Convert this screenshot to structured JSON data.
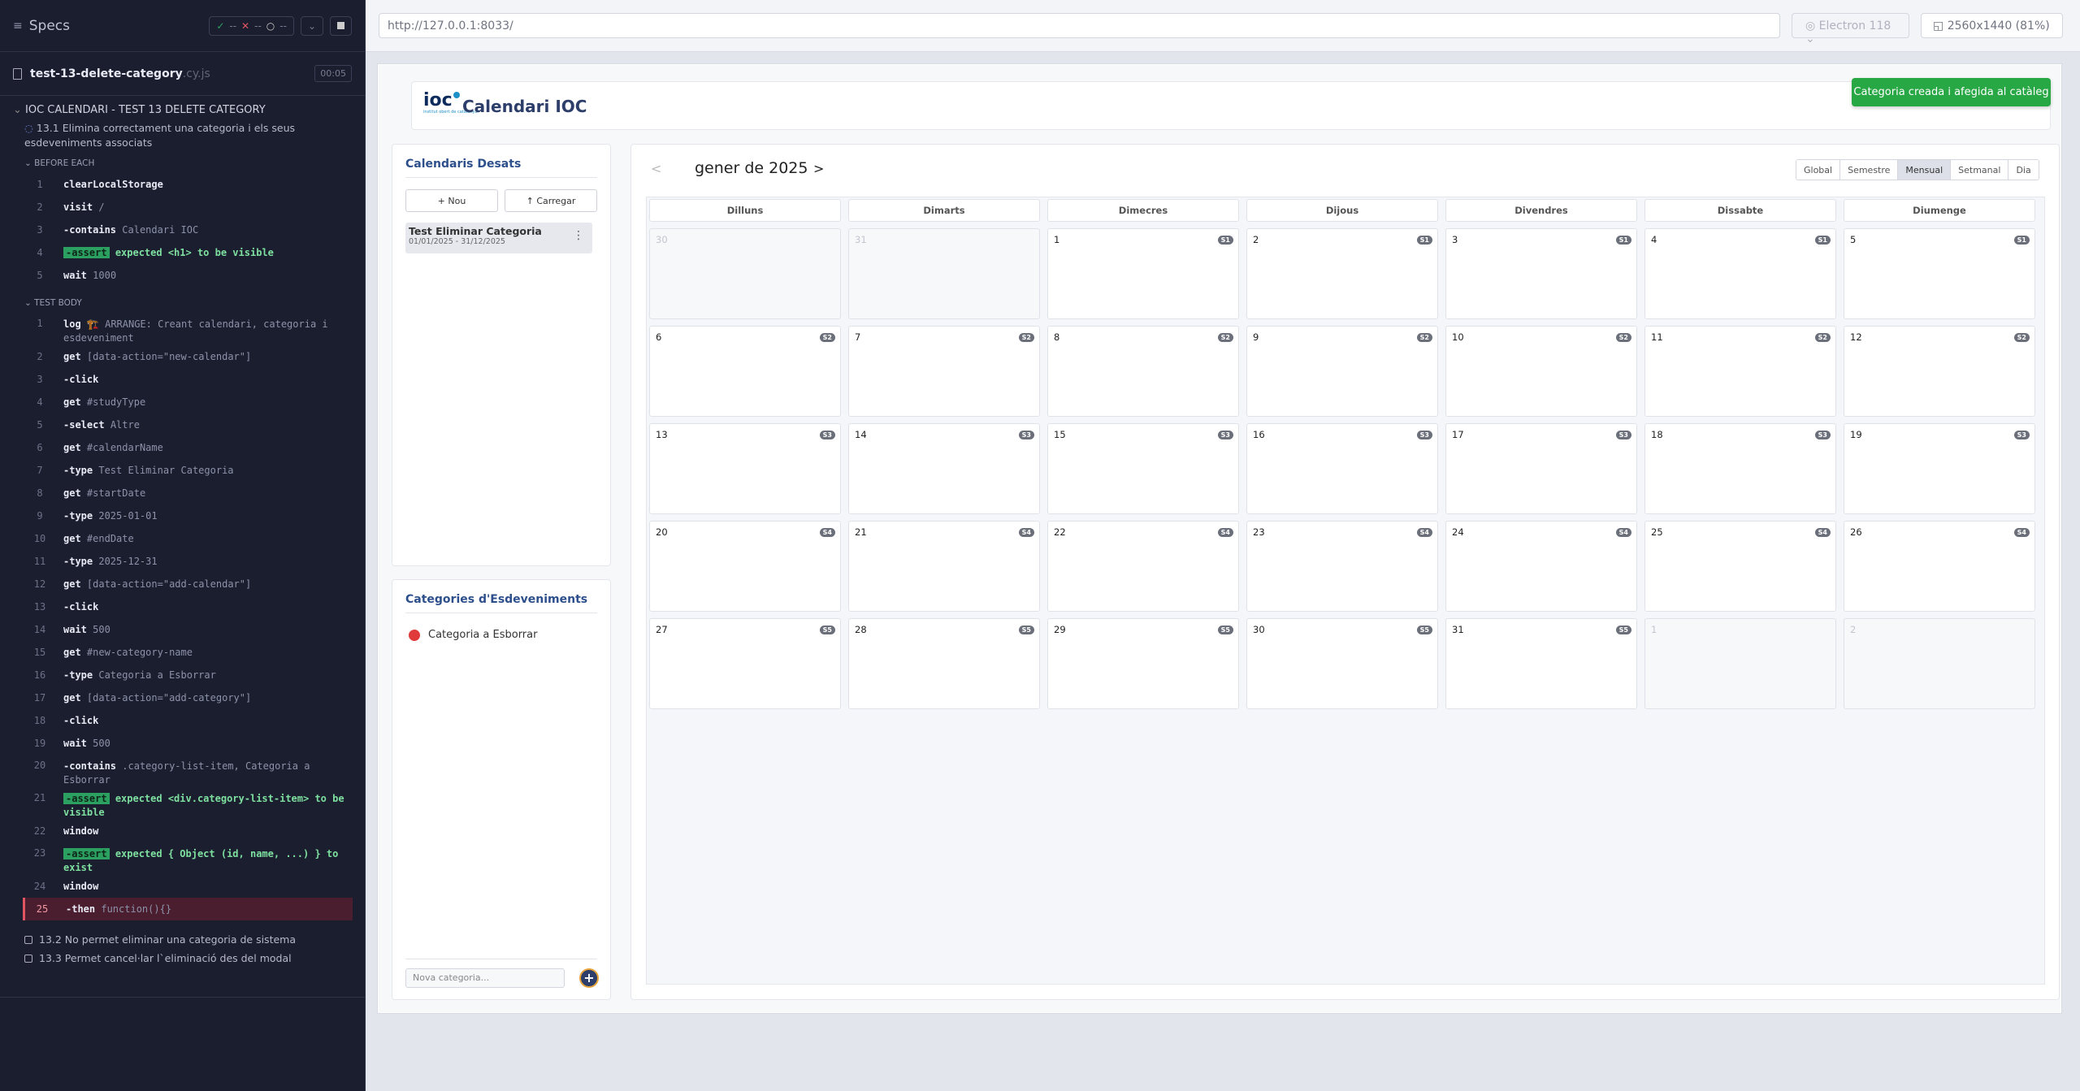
{
  "runner": {
    "header_title": "Specs",
    "pass_count": "--",
    "fail_count": "--",
    "pending_count": "--",
    "file_name": "test-13-delete-category",
    "file_ext": ".cy.js",
    "duration": "00:05",
    "suite_title": "IOC CALENDARI - TEST 13 DELETE CATEGORY",
    "test_title": "13.1 Elimina correctament una categoria i els seus esdeveniments associats",
    "before_each_label": "BEFORE EACH",
    "test_body_label": "TEST BODY",
    "before_each": [
      {
        "n": "1",
        "name": "clearLocalStorage",
        "arg": ""
      },
      {
        "n": "2",
        "name": "visit",
        "arg": "/"
      },
      {
        "n": "3",
        "name": "-contains",
        "arg": "Calendari IOC"
      },
      {
        "n": "4",
        "name": "-assert",
        "arg": "expected <h1> to be visible"
      },
      {
        "n": "5",
        "name": "wait",
        "arg": "1000"
      }
    ],
    "body": [
      {
        "n": "1",
        "name": "log",
        "arg": "🏗️ ARRANGE: Creant calendari, categoria i esdeveniment"
      },
      {
        "n": "2",
        "name": "get",
        "arg": "[data-action=\"new-calendar\"]"
      },
      {
        "n": "3",
        "name": "-click",
        "arg": ""
      },
      {
        "n": "4",
        "name": "get",
        "arg": "#studyType"
      },
      {
        "n": "5",
        "name": "-select",
        "arg": "Altre"
      },
      {
        "n": "6",
        "name": "get",
        "arg": "#calendarName"
      },
      {
        "n": "7",
        "name": "-type",
        "arg": "Test Eliminar Categoria"
      },
      {
        "n": "8",
        "name": "get",
        "arg": "#startDate"
      },
      {
        "n": "9",
        "name": "-type",
        "arg": "2025-01-01"
      },
      {
        "n": "10",
        "name": "get",
        "arg": "#endDate"
      },
      {
        "n": "11",
        "name": "-type",
        "arg": "2025-12-31"
      },
      {
        "n": "12",
        "name": "get",
        "arg": "[data-action=\"add-calendar\"]"
      },
      {
        "n": "13",
        "name": "-click",
        "arg": ""
      },
      {
        "n": "14",
        "name": "wait",
        "arg": "500"
      },
      {
        "n": "15",
        "name": "get",
        "arg": "#new-category-name"
      },
      {
        "n": "16",
        "name": "-type",
        "arg": "Categoria a Esborrar"
      },
      {
        "n": "17",
        "name": "get",
        "arg": "[data-action=\"add-category\"]"
      },
      {
        "n": "18",
        "name": "-click",
        "arg": ""
      },
      {
        "n": "19",
        "name": "wait",
        "arg": "500"
      },
      {
        "n": "20",
        "name": "-contains",
        "arg": ".category-list-item, Categoria a Esborrar"
      },
      {
        "n": "21",
        "name": "-assert",
        "arg": "expected <div.category-list-item> to be visible"
      },
      {
        "n": "22",
        "name": "window",
        "arg": ""
      },
      {
        "n": "23",
        "name": "-assert",
        "arg": "expected { Object (id, name, ...) } to exist"
      },
      {
        "n": "24",
        "name": "window",
        "arg": ""
      },
      {
        "n": "25",
        "name": "-then",
        "arg": "function(){}"
      }
    ],
    "other_tests": [
      "13.2 No permet eliminar una categoria de sistema",
      "13.3 Permet cancel·lar l`eliminació des del modal"
    ]
  },
  "browser_bar": {
    "url": "http://127.0.0.1:8033/",
    "browser": "Electron 118",
    "viewport": "2560x1440  (81%)"
  },
  "app": {
    "title": "Calendari IOC",
    "logo_text": "ioc",
    "logo_sub": "institut obert de catalunya",
    "toast": "Categoria creada i afegida al catàleg",
    "saved_title": "Calendaris Desats",
    "new_btn": "+ Nou",
    "load_btn": "↑ Carregar",
    "calendar_name": "Test Eliminar Categoria",
    "calendar_dates": "01/01/2025 - 31/12/2025",
    "categories_title": "Categories d'Esdeveniments",
    "category_name": "Categoria a Esborrar",
    "category_color": "#e03a3a",
    "new_category_placeholder": "Nova categoria...",
    "month_label": "gener de 2025",
    "prev": "<",
    "next": ">",
    "views": [
      "Global",
      "Semestre",
      "Mensual",
      "Setmanal",
      "Dia"
    ],
    "active_view": "Mensual",
    "weekdays": [
      "Dilluns",
      "Dimarts",
      "Dimecres",
      "Dijous",
      "Divendres",
      "Dissabte",
      "Diumenge"
    ],
    "weeks": [
      {
        "label": "S1",
        "days": [
          {
            "d": "30",
            "out": true
          },
          {
            "d": "31",
            "out": true
          },
          {
            "d": "1"
          },
          {
            "d": "2"
          },
          {
            "d": "3"
          },
          {
            "d": "4"
          },
          {
            "d": "5"
          }
        ]
      },
      {
        "label": "S2",
        "days": [
          {
            "d": "6"
          },
          {
            "d": "7"
          },
          {
            "d": "8"
          },
          {
            "d": "9"
          },
          {
            "d": "10"
          },
          {
            "d": "11"
          },
          {
            "d": "12"
          }
        ]
      },
      {
        "label": "S3",
        "days": [
          {
            "d": "13"
          },
          {
            "d": "14"
          },
          {
            "d": "15"
          },
          {
            "d": "16"
          },
          {
            "d": "17"
          },
          {
            "d": "18"
          },
          {
            "d": "19"
          }
        ]
      },
      {
        "label": "S4",
        "days": [
          {
            "d": "20"
          },
          {
            "d": "21"
          },
          {
            "d": "22"
          },
          {
            "d": "23"
          },
          {
            "d": "24"
          },
          {
            "d": "25"
          },
          {
            "d": "26"
          }
        ]
      },
      {
        "label": "S5",
        "days": [
          {
            "d": "27"
          },
          {
            "d": "28"
          },
          {
            "d": "29"
          },
          {
            "d": "30"
          },
          {
            "d": "31"
          },
          {
            "d": "1",
            "out": true
          },
          {
            "d": "2",
            "out": true
          }
        ]
      }
    ]
  }
}
